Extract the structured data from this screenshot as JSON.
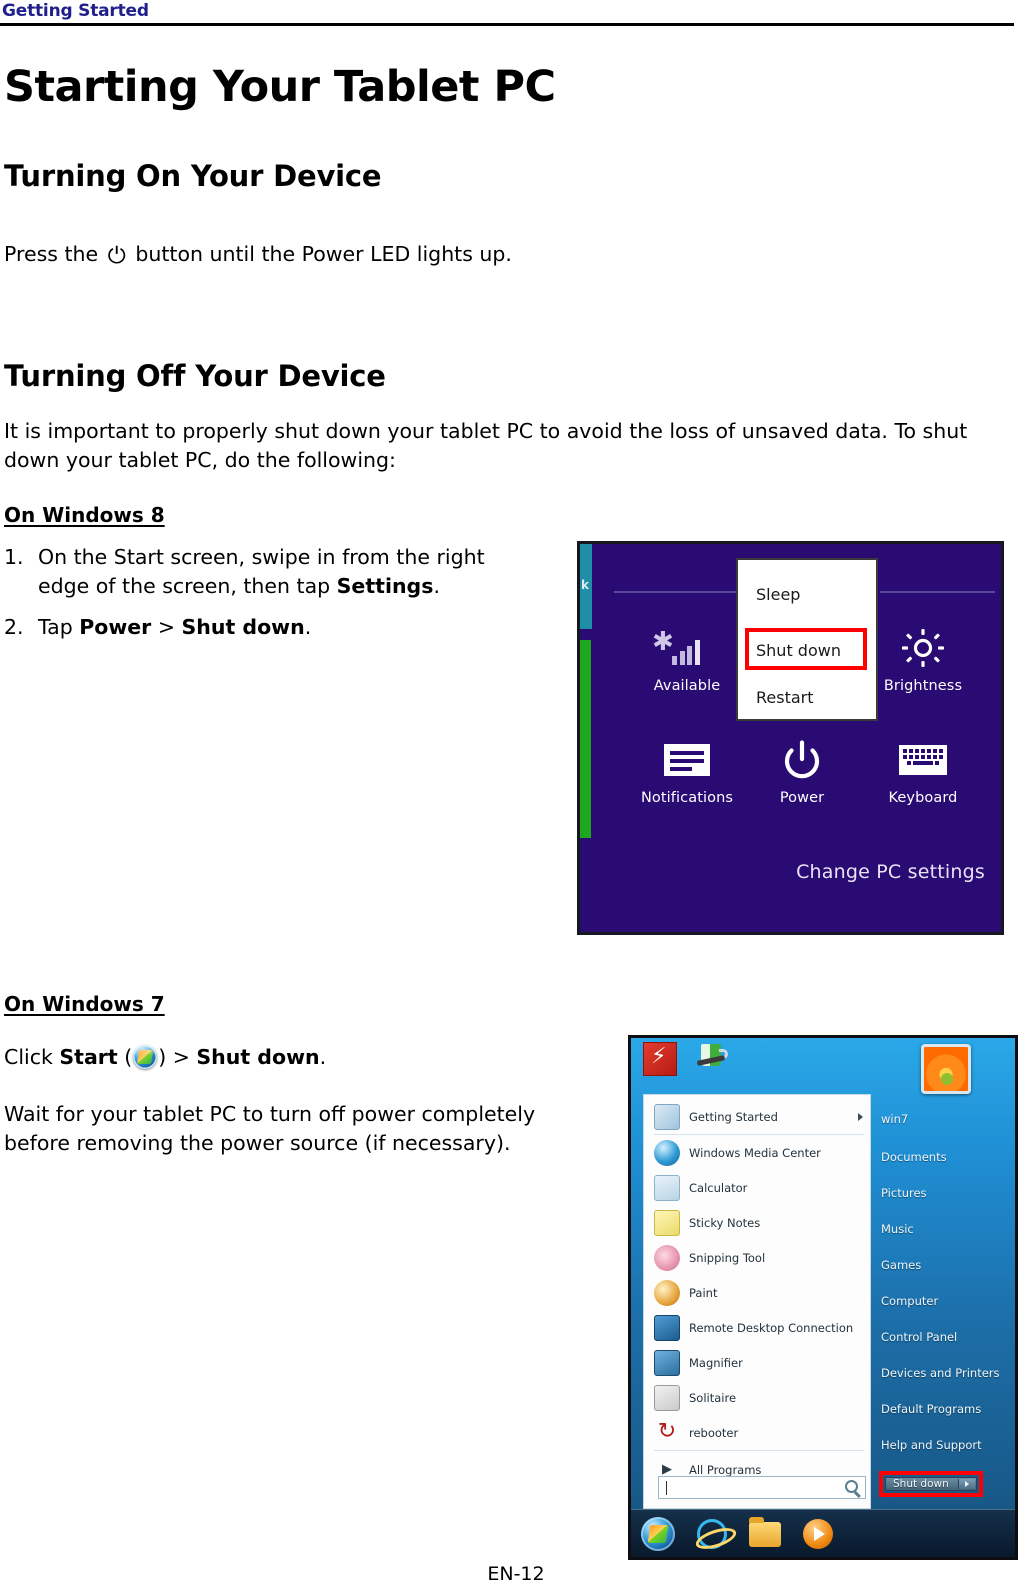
{
  "header": {
    "running_head": "Getting Started"
  },
  "page_title": "Starting Your Tablet PC",
  "sections": {
    "turning_on": {
      "heading": "Turning On Your Device",
      "text_before_icon": "Press the",
      "power_icon": "power-icon",
      "text_after_icon": "button until the Power LED lights up."
    },
    "turning_off": {
      "heading": "Turning Off Your Device",
      "intro": "It is important to properly shut down your tablet PC to avoid the loss of unsaved data. To shut down your tablet PC, do the following:",
      "windows8": {
        "sub_heading": "On Windows 8",
        "steps": [
          {
            "number": "1.",
            "text_plain_1": "On the Start screen, swipe in from the right edge of the screen, then tap ",
            "bold_1": "Settings",
            "text_plain_2": "."
          },
          {
            "number": "2.",
            "text_plain_1": "Tap ",
            "bold_1": "Power",
            "text_plain_2": " > ",
            "bold_2": "Shut down",
            "text_plain_3": "."
          }
        ]
      },
      "windows7": {
        "sub_heading": "On Windows 7",
        "click_line": {
          "prefix": "Click ",
          "bold_start": "Start",
          "paren_open": " (",
          "orb_icon": "windows-start-orb-icon",
          "paren_close": ") > ",
          "bold_shutdown": "Shut down",
          "suffix": "."
        },
        "wait_text": "Wait for your tablet PC to turn off power completely before removing the power source (if necessary)."
      }
    }
  },
  "win8_screenshot": {
    "name": "windows-8-settings-charm-screenshot",
    "background_color": "#2a0a73",
    "tiles": {
      "teal_label": "k",
      "teal_color": "#1f8fa8",
      "green_color": "#1fa81f"
    },
    "icons": [
      {
        "id": "network-available",
        "label": "Available"
      },
      {
        "id": "brightness",
        "label": "Brightness"
      },
      {
        "id": "notifications",
        "label": "Notifications"
      },
      {
        "id": "power",
        "label": "Power"
      },
      {
        "id": "keyboard",
        "label": "Keyboard"
      }
    ],
    "power_menu": {
      "items": [
        "Sleep",
        "Shut down",
        "Restart"
      ],
      "highlighted": "Shut down",
      "highlight_color": "#ff0000"
    },
    "change_pc_settings": "Change PC settings"
  },
  "win7_screenshot": {
    "name": "windows-7-start-menu-screenshot",
    "programs": [
      {
        "label": "Getting Started",
        "icon": "getting-started-icon",
        "submenu": true
      },
      {
        "label": "Windows Media Center",
        "icon": "media-center-icon",
        "submenu": false
      },
      {
        "label": "Calculator",
        "icon": "calculator-icon",
        "submenu": false
      },
      {
        "label": "Sticky Notes",
        "icon": "sticky-notes-icon",
        "submenu": false
      },
      {
        "label": "Snipping Tool",
        "icon": "snipping-tool-icon",
        "submenu": false
      },
      {
        "label": "Paint",
        "icon": "paint-icon",
        "submenu": false
      },
      {
        "label": "Remote Desktop Connection",
        "icon": "remote-desktop-icon",
        "submenu": false
      },
      {
        "label": "Magnifier",
        "icon": "magnifier-icon",
        "submenu": false
      },
      {
        "label": "Solitaire",
        "icon": "solitaire-icon",
        "submenu": false
      },
      {
        "label": "rebooter",
        "icon": "rebooter-icon",
        "submenu": false
      }
    ],
    "all_programs": "All Programs",
    "search_placeholder": "",
    "right_links": [
      "win7",
      "Documents",
      "Pictures",
      "Music",
      "Games",
      "Computer",
      "Control Panel",
      "Devices and Printers",
      "Default Programs",
      "Help and Support"
    ],
    "shutdown_button": "Shut down",
    "shutdown_highlight_color": "#ff0000",
    "taskbar_icons": [
      "start-orb-icon",
      "internet-explorer-icon",
      "file-explorer-icon",
      "media-player-icon"
    ]
  },
  "footer": {
    "page_number": "EN-12"
  }
}
